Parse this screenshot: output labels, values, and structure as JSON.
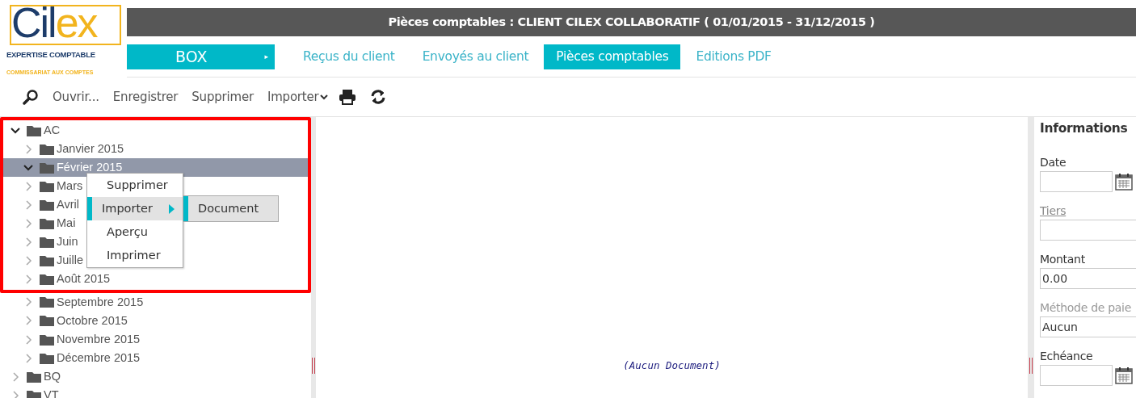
{
  "logo": {
    "word_start": "Cil",
    "word_end": "ex",
    "line1": "EXPERTISE COMPTABLE",
    "line2": "COMMISSARIAT AUX COMPTES"
  },
  "title": "Pièces comptables : CLIENT CILEX COLLABORATIF ( 01/01/2015 - 31/12/2015 )",
  "box_button": {
    "label": "BOX",
    "arrow": "▸"
  },
  "tabs": [
    {
      "label": "Reçus du client",
      "selected": false
    },
    {
      "label": "Envoyés au client",
      "selected": false
    },
    {
      "label": "Pièces comptables",
      "selected": true
    },
    {
      "label": "Editions PDF",
      "selected": false
    }
  ],
  "toolbar": [
    {
      "kind": "search"
    },
    {
      "kind": "text",
      "label": "Ouvrir..."
    },
    {
      "kind": "text",
      "label": "Enregistrer"
    },
    {
      "kind": "text",
      "label": "Supprimer"
    },
    {
      "kind": "dropdown",
      "label": "Importer"
    },
    {
      "kind": "print"
    },
    {
      "kind": "refresh"
    }
  ],
  "tree": [
    {
      "label": "AC",
      "expanded": true,
      "selected": false,
      "children": [
        {
          "label": "Janvier 2015",
          "expanded": false,
          "selected": false
        },
        {
          "label": "Février 2015",
          "expanded": true,
          "selected": true
        },
        {
          "label": "Mars",
          "expanded": false,
          "selected": false
        },
        {
          "label": "Avril",
          "expanded": false,
          "selected": false
        },
        {
          "label": "Mai",
          "expanded": false,
          "selected": false
        },
        {
          "label": "Juin",
          "expanded": false,
          "selected": false
        },
        {
          "label": "Juille",
          "expanded": false,
          "selected": false
        },
        {
          "label": "Août 2015",
          "expanded": false,
          "selected": false
        },
        {
          "label": "Septembre 2015",
          "expanded": false,
          "selected": false
        },
        {
          "label": "Octobre 2015",
          "expanded": false,
          "selected": false
        },
        {
          "label": "Novembre 2015",
          "expanded": false,
          "selected": false
        },
        {
          "label": "Décembre 2015",
          "expanded": false,
          "selected": false
        }
      ]
    },
    {
      "label": "BQ",
      "expanded": false,
      "selected": false
    },
    {
      "label": "VT",
      "expanded": false,
      "selected": false
    }
  ],
  "highlight_frame": true,
  "context_menu": {
    "items": [
      {
        "label": "Supprimer",
        "selected": false,
        "has_submenu": false
      },
      {
        "label": "Importer",
        "selected": true,
        "has_submenu": true
      },
      {
        "label": "Aperçu",
        "selected": false,
        "has_submenu": false
      },
      {
        "label": "Imprimer",
        "selected": false,
        "has_submenu": false
      }
    ],
    "submenu": [
      {
        "label": "Document",
        "selected": true
      }
    ]
  },
  "viewer": {
    "message": "(Aucun Document)"
  },
  "info_panel": {
    "title": "Informations",
    "fields": [
      {
        "label": "Date",
        "kind": "date",
        "disabled": false,
        "link": false
      },
      {
        "label": "Tiers",
        "kind": "text",
        "disabled": false,
        "link": true
      },
      {
        "label": "Montant",
        "kind": "text",
        "value": "0.00",
        "disabled": false,
        "link": false
      },
      {
        "label": "Méthode de paie",
        "kind": "select",
        "value": "Aucun",
        "disabled": true,
        "link": false
      },
      {
        "label": "Echéance",
        "kind": "date",
        "disabled": false,
        "link": false
      }
    ]
  }
}
